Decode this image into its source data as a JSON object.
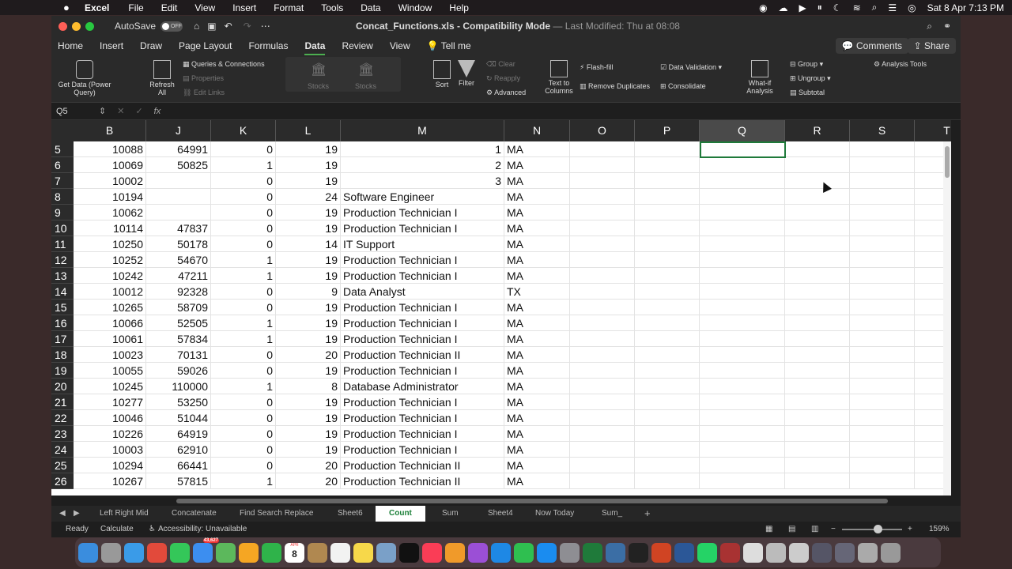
{
  "menubar": {
    "app": "Excel",
    "items": [
      "File",
      "Edit",
      "View",
      "Insert",
      "Format",
      "Tools",
      "Data",
      "Window",
      "Help"
    ],
    "datetime": "Sat 8 Apr  7:13 PM"
  },
  "window": {
    "autosave_label": "AutoSave",
    "autosave_state": "OFF",
    "title": "Concat_Functions.xls",
    "mode": " - Compatibility Mode",
    "modified": "— Last Modified: Thu at 08:08"
  },
  "ribbon_tabs": [
    "Home",
    "Insert",
    "Draw",
    "Page Layout",
    "Formulas",
    "Data",
    "Review",
    "View"
  ],
  "tell_me": "Tell me",
  "comments_label": "Comments",
  "share_label": "Share",
  "ribbon": {
    "get_data": "Get Data (Power Query)",
    "refresh_all": "Refresh All",
    "queries": "Queries & Connections",
    "properties": "Properties",
    "edit_links": "Edit Links",
    "stocks1": "Stocks",
    "stocks2": "Stocks",
    "sort": "Sort",
    "filter": "Filter",
    "clear": "Clear",
    "reapply": "Reapply",
    "advanced": "Advanced",
    "text_to_columns": "Text to Columns",
    "flash_fill": "Flash-fill",
    "remove_duplicates": "Remove Duplicates",
    "data_validation": "Data Validation",
    "consolidate": "Consolidate",
    "what_if": "What-if Analysis",
    "group": "Group",
    "ungroup": "Ungroup",
    "subtotal": "Subtotal",
    "analysis_tools": "Analysis Tools"
  },
  "formula_bar": {
    "name_box": "Q5",
    "fx": "fx",
    "content": ""
  },
  "columns": [
    "B",
    "J",
    "K",
    "L",
    "M",
    "N",
    "O",
    "P",
    "Q",
    "R",
    "S",
    "T"
  ],
  "rows": [
    {
      "n": "5",
      "B": "10088",
      "J": "64991",
      "K": "0",
      "L": "19",
      "M": "1",
      "N": "MA"
    },
    {
      "n": "6",
      "B": "10069",
      "J": "50825",
      "K": "1",
      "L": "19",
      "M": "2",
      "N": "MA"
    },
    {
      "n": "7",
      "B": "10002",
      "J": "",
      "K": "0",
      "L": "19",
      "M": "3",
      "N": "MA"
    },
    {
      "n": "8",
      "B": "10194",
      "J": "",
      "K": "0",
      "L": "24",
      "M": "Software Engineer",
      "N": "MA"
    },
    {
      "n": "9",
      "B": "10062",
      "J": "",
      "K": "0",
      "L": "19",
      "M": "Production Technician I",
      "N": "MA"
    },
    {
      "n": "10",
      "B": "10114",
      "J": "47837",
      "K": "0",
      "L": "19",
      "M": "Production Technician I",
      "N": "MA"
    },
    {
      "n": "11",
      "B": "10250",
      "J": "50178",
      "K": "0",
      "L": "14",
      "M": "IT Support",
      "N": "MA"
    },
    {
      "n": "12",
      "B": "10252",
      "J": "54670",
      "K": "1",
      "L": "19",
      "M": "Production Technician I",
      "N": "MA"
    },
    {
      "n": "13",
      "B": "10242",
      "J": "47211",
      "K": "1",
      "L": "19",
      "M": "Production Technician I",
      "N": "MA"
    },
    {
      "n": "14",
      "B": "10012",
      "J": "92328",
      "K": "0",
      "L": "9",
      "M": "Data Analyst",
      "N": "TX"
    },
    {
      "n": "15",
      "B": "10265",
      "J": "58709",
      "K": "0",
      "L": "19",
      "M": "Production Technician I",
      "N": "MA"
    },
    {
      "n": "16",
      "B": "10066",
      "J": "52505",
      "K": "1",
      "L": "19",
      "M": "Production Technician I",
      "N": "MA"
    },
    {
      "n": "17",
      "B": "10061",
      "J": "57834",
      "K": "1",
      "L": "19",
      "M": "Production Technician I",
      "N": "MA"
    },
    {
      "n": "18",
      "B": "10023",
      "J": "70131",
      "K": "0",
      "L": "20",
      "M": "Production Technician II",
      "N": "MA"
    },
    {
      "n": "19",
      "B": "10055",
      "J": "59026",
      "K": "0",
      "L": "19",
      "M": "Production Technician I",
      "N": "MA"
    },
    {
      "n": "20",
      "B": "10245",
      "J": "110000",
      "K": "1",
      "L": "8",
      "M": "Database Administrator",
      "N": "MA"
    },
    {
      "n": "21",
      "B": "10277",
      "J": "53250",
      "K": "0",
      "L": "19",
      "M": "Production Technician I",
      "N": "MA"
    },
    {
      "n": "22",
      "B": "10046",
      "J": "51044",
      "K": "0",
      "L": "19",
      "M": "Production Technician I",
      "N": "MA"
    },
    {
      "n": "23",
      "B": "10226",
      "J": "64919",
      "K": "0",
      "L": "19",
      "M": "Production Technician I",
      "N": "MA"
    },
    {
      "n": "24",
      "B": "10003",
      "J": "62910",
      "K": "0",
      "L": "19",
      "M": "Production Technician I",
      "N": "MA"
    },
    {
      "n": "25",
      "B": "10294",
      "J": "66441",
      "K": "0",
      "L": "20",
      "M": "Production Technician II",
      "N": "MA"
    },
    {
      "n": "26",
      "B": "10267",
      "J": "57815",
      "K": "1",
      "L": "20",
      "M": "Production Technician II",
      "N": "MA"
    }
  ],
  "sheets": [
    "Left Right Mid",
    "Concatenate",
    "Find Search Replace",
    "Sheet6",
    "Count",
    "Sum",
    "Sheet4",
    "Now Today",
    "Sum_"
  ],
  "active_sheet": "Count",
  "status": {
    "ready": "Ready",
    "calculate": "Calculate",
    "accessibility": "Accessibility: Unavailable",
    "zoom": "159%"
  },
  "dock": {
    "mail_badge": "43,627",
    "calendar_month": "APR",
    "calendar_day": "8"
  }
}
